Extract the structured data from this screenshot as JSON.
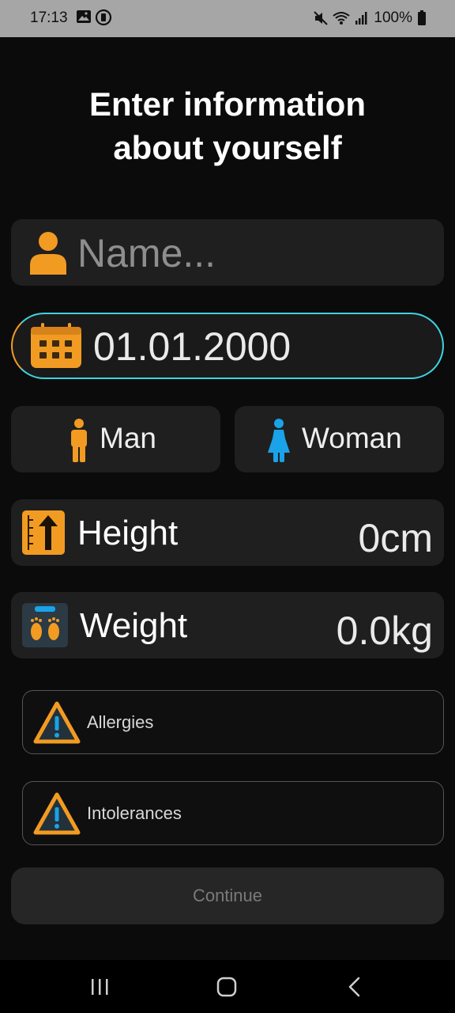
{
  "status_bar": {
    "time": "17:13",
    "battery": "100%"
  },
  "page": {
    "title_line1": "Enter information",
    "title_line2": "about yourself"
  },
  "name_field": {
    "placeholder": "Name..."
  },
  "birthdate_field": {
    "value": "01.01.2000"
  },
  "gender": {
    "man_label": "Man",
    "woman_label": "Woman"
  },
  "height": {
    "label": "Height",
    "value": "0cm"
  },
  "weight": {
    "label": "Weight",
    "value": "0.0kg"
  },
  "allergies": {
    "label": "Allergies"
  },
  "intolerances": {
    "label": "Intolerances"
  },
  "continue_button": {
    "label": "Continue"
  },
  "colors": {
    "orange": "#f29b22",
    "cyan": "#3dd3e0",
    "blue": "#1aa3e8"
  }
}
